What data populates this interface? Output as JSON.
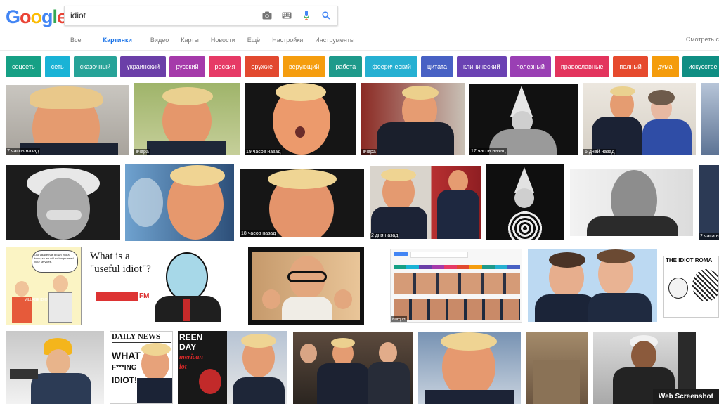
{
  "logo": {
    "letters": [
      "G",
      "o",
      "o",
      "g",
      "l",
      "e"
    ],
    "colors": [
      "#4285f4",
      "#ea4335",
      "#fbbc05",
      "#4285f4",
      "#34a853",
      "#ea4335"
    ]
  },
  "search": {
    "value": "idiot"
  },
  "tabs": {
    "all": "Все",
    "images": "Картинки",
    "video": "Видео",
    "maps": "Карты",
    "news": "Новости",
    "more": "Ещё",
    "settings": "Настройки",
    "tools": "Инструменты",
    "watch": "Смотреть с"
  },
  "chips": [
    {
      "label": "соцсеть",
      "color": "#16a085"
    },
    {
      "label": "сеть",
      "color": "#1ab3d6"
    },
    {
      "label": "сказочный",
      "color": "#27a398"
    },
    {
      "label": "украинский",
      "color": "#6b3fa8"
    },
    {
      "label": "русский",
      "color": "#a53aaa"
    },
    {
      "label": "россия",
      "color": "#e63a66"
    },
    {
      "label": "оружие",
      "color": "#e2492f"
    },
    {
      "label": "верующий",
      "color": "#f59d0e"
    },
    {
      "label": "работа",
      "color": "#1e9a8b"
    },
    {
      "label": "феерический",
      "color": "#26b0d2"
    },
    {
      "label": "цитата",
      "color": "#4861c4"
    },
    {
      "label": "клинический",
      "color": "#6b42b3"
    },
    {
      "label": "полезный",
      "color": "#9a3fb4"
    },
    {
      "label": "православные",
      "color": "#e3345d"
    },
    {
      "label": "полный",
      "color": "#e64a2e"
    },
    {
      "label": "дума",
      "color": "#f49c0c"
    },
    {
      "label": "искусстве",
      "color": "#0f8e83"
    }
  ],
  "captions": {
    "r1c1": "7 часов назад",
    "r1c2": "вчера",
    "r1c3": "19 часов назад",
    "r1c4": "вчера",
    "r1c5": "17 часов назад",
    "r1c6": "6 дней назад",
    "r2c4": "18 часов назад",
    "r2c5": "2 дня назад",
    "r2c8": "2 часа н",
    "r3c4": "вчера"
  },
  "imgtext": {
    "useful1": "What is a",
    "useful2": "\"useful idiot\"?",
    "fm": "FM",
    "comic": "Our village has grown into a town, so we will no longer need your services.",
    "village": "VILLAGE IDIOT",
    "idiotroma": "THE IDIOT ROMA",
    "daily": "DAILY NEWS",
    "what": "WHAT A",
    "fing": "F***ING",
    "idiot": "IDIOT!",
    "green": "REEN",
    "day": "DAY",
    "american": "merican",
    "iot": "iot"
  },
  "watermark": "Web Screenshot"
}
